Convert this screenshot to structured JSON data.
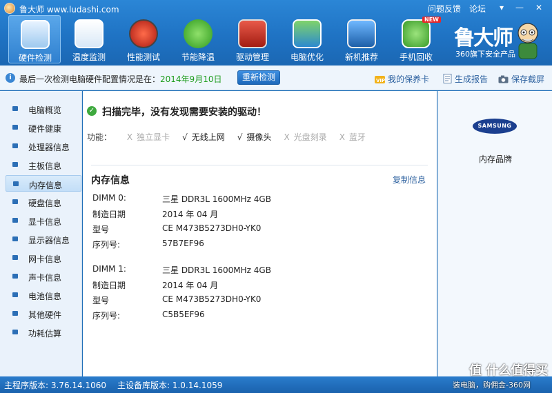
{
  "window": {
    "title": "鲁大师 www.ludashi.com",
    "links": [
      "问题反馈",
      "论坛"
    ]
  },
  "nav": [
    {
      "label": "硬件检测",
      "icon": "monitor-magnifier-icon",
      "active": true
    },
    {
      "label": "温度监测",
      "icon": "thermometer-icon"
    },
    {
      "label": "性能测试",
      "icon": "speedometer-icon"
    },
    {
      "label": "节能降温",
      "icon": "clover-icon"
    },
    {
      "label": "驱动管理",
      "icon": "toolbox-icon"
    },
    {
      "label": "电脑优化",
      "icon": "broom-screen-icon"
    },
    {
      "label": "新机推荐",
      "icon": "monitor-medal-icon"
    },
    {
      "label": "手机回收",
      "icon": "phone-recycle-icon",
      "badge": "NEW"
    }
  ],
  "brand": {
    "logo": "鲁大师",
    "sub": "360旗下安全产品"
  },
  "infobar": {
    "text": "最后一次检测电脑硬件配置情况是在：",
    "date": "2014年9月10日",
    "redetect": "重新检测",
    "links": [
      "我的保养卡",
      "生成报告",
      "保存截屏"
    ]
  },
  "sidebar": [
    "电脑概览",
    "硬件健康",
    "处理器信息",
    "主板信息",
    "内存信息",
    "硬盘信息",
    "显卡信息",
    "显示器信息",
    "网卡信息",
    "声卡信息",
    "电池信息",
    "其他硬件",
    "功耗估算"
  ],
  "sidebar_active": "内存信息",
  "main": {
    "scan_msg": "扫描完毕，没有发现需要安装的驱动！",
    "features_label": "功能：",
    "features": [
      {
        "mark": "X",
        "name": "独立显卡",
        "on": false
      },
      {
        "mark": "√",
        "name": "无线上网",
        "on": true
      },
      {
        "mark": "√",
        "name": "摄像头",
        "on": true
      },
      {
        "mark": "X",
        "name": "光盘刻录",
        "on": false
      },
      {
        "mark": "X",
        "name": "蓝牙",
        "on": false
      }
    ],
    "section_title": "内存信息",
    "copy_link": "复制信息",
    "modules": [
      {
        "rows": [
          {
            "k": "DIMM 0:",
            "v": "三星 DDR3L 1600MHz 4GB"
          },
          {
            "k": "制造日期",
            "v": "2014 年 04 月"
          },
          {
            "k": "型号",
            "v": "CE M473B5273DH0-YK0"
          },
          {
            "k": "序列号:",
            "v": "57B7EF96"
          }
        ]
      },
      {
        "rows": [
          {
            "k": "DIMM 1:",
            "v": "三星 DDR3L 1600MHz 4GB"
          },
          {
            "k": "制造日期",
            "v": "2014 年 04 月"
          },
          {
            "k": "型号",
            "v": "CE M473B5273DH0-YK0"
          },
          {
            "k": "序列号:",
            "v": "C5B5EF96"
          }
        ]
      }
    ]
  },
  "rightpanel": {
    "logo_text": "SAMSUNG",
    "caption": "内存品牌"
  },
  "status": {
    "main_version": "主程序版本: 3.76.14.1060",
    "db_version": "主设备库版本: 1.0.14.1059"
  },
  "watermark": {
    "text": "值 什么值得买",
    "sub": "装电脑，购佣金-360网"
  }
}
